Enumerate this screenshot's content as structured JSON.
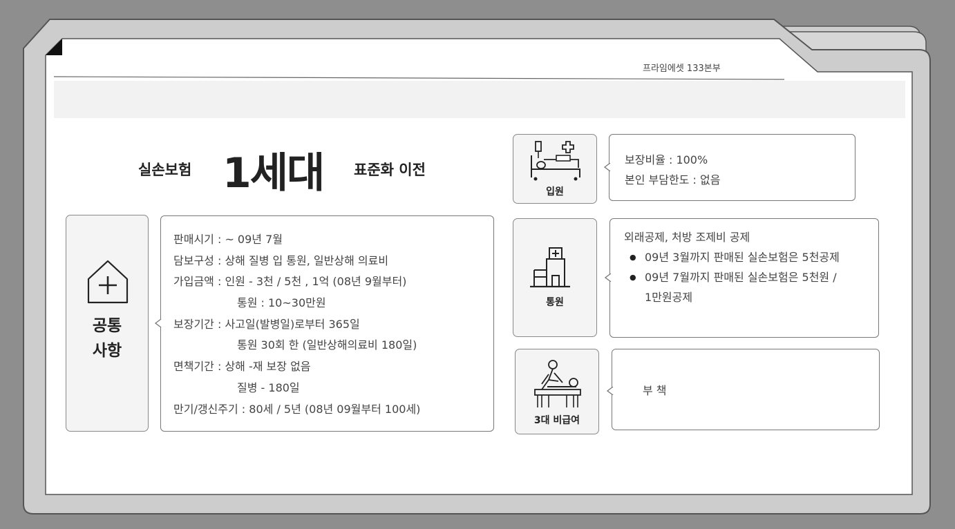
{
  "header": {
    "org_label": "프라임에셋 133본부"
  },
  "title": {
    "prefix": "실손보험",
    "main": "1세대",
    "suffix": "표준화 이전"
  },
  "common": {
    "label": "공통\n사항",
    "icon": "house-plus-icon",
    "details": [
      "판매시기 :   ~ 09년 7월",
      "담보구성 : 상해 질병 입 통원, 일반상해 의료비",
      "가입금액 :  인원 - 3천 / 5천 , 1억 (08년 9월부터)",
      "통원 : 10~30만원",
      "보장기간 : 사고일(발병일)로부터 365일",
      "통원 30회 한 (일반상해의료비 180일)",
      "면책기간 : 상해 -재 보장 없음",
      "질병 - 180일",
      "만기/갱신주기 : 80세 / 5년 (08년 09월부터 100세)"
    ]
  },
  "sections": {
    "inpatient": {
      "label": "입원",
      "icon": "hospital-bed-icon",
      "lines": [
        "보장비율 : 100%",
        "본인 부담한도 : 없음"
      ]
    },
    "outpatient": {
      "label": "통원",
      "icon": "hospital-building-icon",
      "heading": "외래공제, 처방 조제비 공제",
      "bullets": [
        "09년 3월까지 판매된 실손보험은 5천공제",
        "09년 7월까지 판매된 실손보험은 5천원 / 1만원공제"
      ]
    },
    "non_covered": {
      "label": "3대 비급여",
      "icon": "massage-therapy-icon",
      "text": "부 책"
    }
  },
  "colors": {
    "background": "#8e8e8e",
    "panel": "#ffffff",
    "tile": "#f4f4f4",
    "border": "#777777"
  }
}
